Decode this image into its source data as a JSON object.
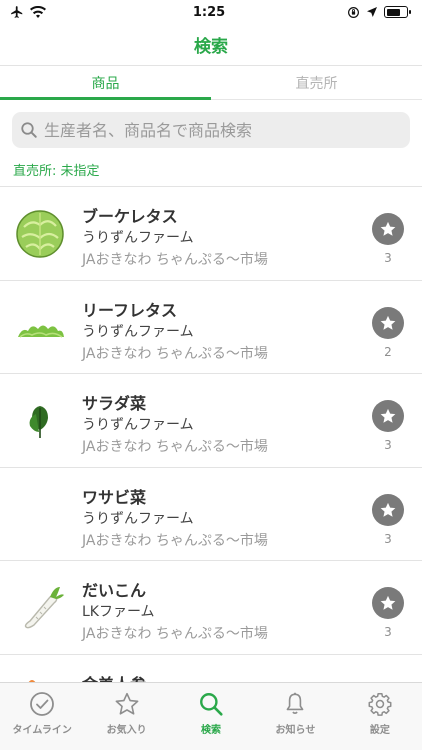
{
  "status_bar": {
    "time": "1:25"
  },
  "header": {
    "title": "検索"
  },
  "tabs": [
    {
      "label": "商品",
      "active": true
    },
    {
      "label": "直売所",
      "active": false
    }
  ],
  "search": {
    "placeholder": "生産者名、商品名で商品検索",
    "value": ""
  },
  "filter": {
    "label": "直売所: 未指定"
  },
  "products": [
    {
      "name": "ブーケレタス",
      "farm": "うりずんファーム",
      "market": "JAおきなわ ちゃんぷる〜市場",
      "favorites": "3",
      "icon": "lettuce-icon"
    },
    {
      "name": "リーフレタス",
      "farm": "うりずんファーム",
      "market": "JAおきなわ ちゃんぷる〜市場",
      "favorites": "2",
      "icon": "leaf-lettuce-icon"
    },
    {
      "name": "サラダ菜",
      "farm": "うりずんファーム",
      "market": "JAおきなわ ちゃんぷる〜市場",
      "favorites": "3",
      "icon": "spinach-icon"
    },
    {
      "name": "ワサビ菜",
      "farm": "うりずんファーム",
      "market": "JAおきなわ ちゃんぷる〜市場",
      "favorites": "3",
      "icon": ""
    },
    {
      "name": "だいこん",
      "farm": "LKファーム",
      "market": "JAおきなわ ちゃんぷる〜市場",
      "favorites": "3",
      "icon": "daikon-icon"
    },
    {
      "name": "金美人参",
      "farm": "",
      "market": "",
      "favorites": "",
      "icon": "carrot-icon"
    }
  ],
  "tab_bar": [
    {
      "label": "タイムライン",
      "icon": "clock-check-icon",
      "active": false
    },
    {
      "label": "お気入り",
      "icon": "star-outline-icon",
      "active": false
    },
    {
      "label": "検索",
      "icon": "search-icon",
      "active": true
    },
    {
      "label": "お知らせ",
      "icon": "bell-icon",
      "active": false
    },
    {
      "label": "設定",
      "icon": "gear-icon",
      "active": false
    }
  ],
  "colors": {
    "accent": "#2aa84a",
    "fav_button": "#7a7a7a",
    "muted_text": "#9a9a9a"
  }
}
